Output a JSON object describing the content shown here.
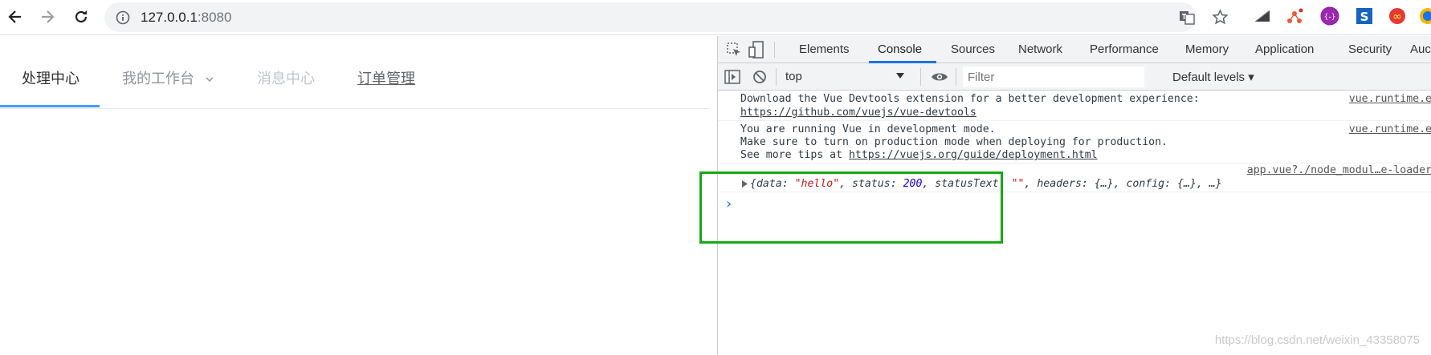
{
  "browser": {
    "url_host": "127.0.0.1",
    "url_port": ":8080"
  },
  "page": {
    "tabs": [
      {
        "label": "处理中心",
        "color": "#303133"
      },
      {
        "label": "我的工作台",
        "color": "#909399"
      },
      {
        "label": "消息中心",
        "color": "#c0c4cc"
      },
      {
        "label": "订单管理",
        "color": "#606266"
      }
    ],
    "accent": "#409eff"
  },
  "devtools": {
    "tabs": [
      "Elements",
      "Console",
      "Sources",
      "Network",
      "Performance",
      "Memory",
      "Application",
      "Security",
      "Auc"
    ],
    "active_tab": "Console",
    "context": "top",
    "filter_placeholder": "Filter",
    "levels": "Default levels ▾",
    "messages": [
      {
        "line1": "Download the Vue Devtools extension for a better development experience:",
        "line2": "https://github.com/vuejs/vue-devtools",
        "source": "vue.runtime.e"
      },
      {
        "line1": "You are running Vue in development mode.",
        "line2": "Make sure to turn on production mode when deploying for production.",
        "line3_prefix": "See more tips at ",
        "line3_link": "https://vuejs.org/guide/deployment.html",
        "source": "vue.runtime.e"
      },
      {
        "source": "app.vue?./node_modul…e-loader",
        "object": {
          "open": "{",
          "k1": "data: ",
          "v1": "\"hello\"",
          "k2": ", status: ",
          "v2": "200",
          "k3": ", statusText: ",
          "v3": "\"\"",
          "k4": ", headers: {…}, config: {…}, …}"
        }
      }
    ],
    "prompt": "›"
  },
  "watermark": "https://blog.csdn.net/weixin_43358075"
}
